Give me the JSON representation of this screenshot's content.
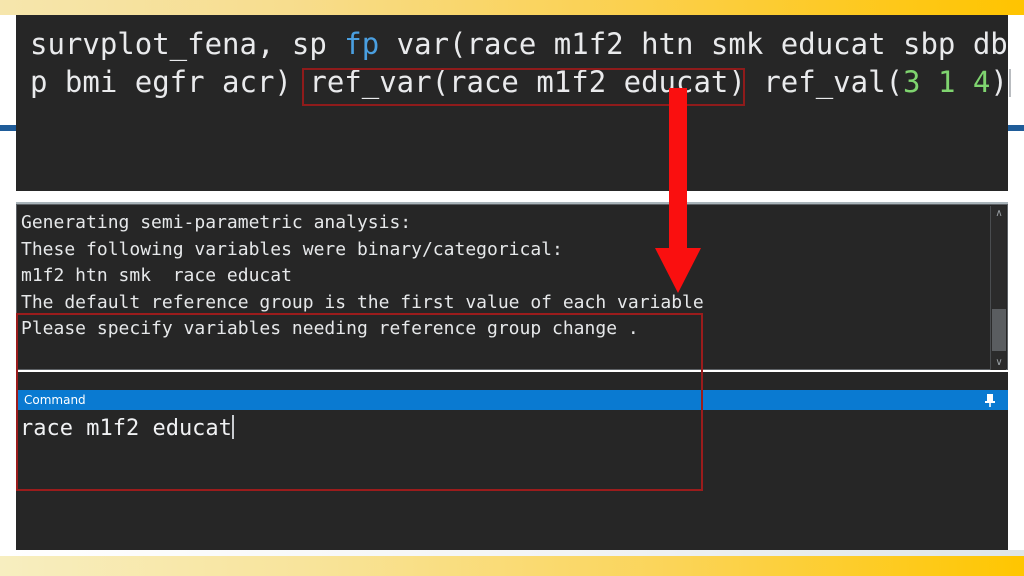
{
  "editor": {
    "line1_pre": "survplot_fena, sp ",
    "line1_fp": "fp",
    "line1_post": " var(race m1f2 htn smk educat sbp db",
    "line2_pre": "p bmi egfr acr) ",
    "line2_refvar": "ref_var(race m1f2 educat)",
    "line2_mid": " ref_val(",
    "line2_v1": "3",
    "line2_sp1": " ",
    "line2_v2": "1",
    "line2_sp2": " ",
    "line2_v3": "4",
    "line2_close": ")"
  },
  "results": {
    "lines": [
      "Generating semi-parametric analysis:",
      "These following variables were binary/categorical:",
      "m1f2 htn smk  race educat",
      "The default reference group is the first value of each variable",
      "Please specify variables needing reference group change ."
    ],
    "text": "Generating semi-parametric analysis:\nThese following variables were binary/categorical:\nm1f2 htn smk  race educat\nThe default reference group is the first value of each variable\nPlease specify variables needing reference group change .",
    "scrollbar": {
      "up_glyph": "∧",
      "down_glyph": "∨"
    }
  },
  "command": {
    "title": "Command",
    "pin_icon": "pin-icon",
    "value": "race m1f2 educat"
  },
  "annotations": {
    "arrow": "down-arrow",
    "highlight_color": "#9b1c1c",
    "arrow_color": "#fa0f0f"
  },
  "colors": {
    "panel_bg": "#262626",
    "text": "#e9eaec",
    "keyword_blue": "#4a9fe0",
    "number_green": "#7fd46f",
    "title_blue": "#0a7ad1",
    "band_yellow": "#ffc400",
    "rule_blue": "#1f5c99"
  }
}
